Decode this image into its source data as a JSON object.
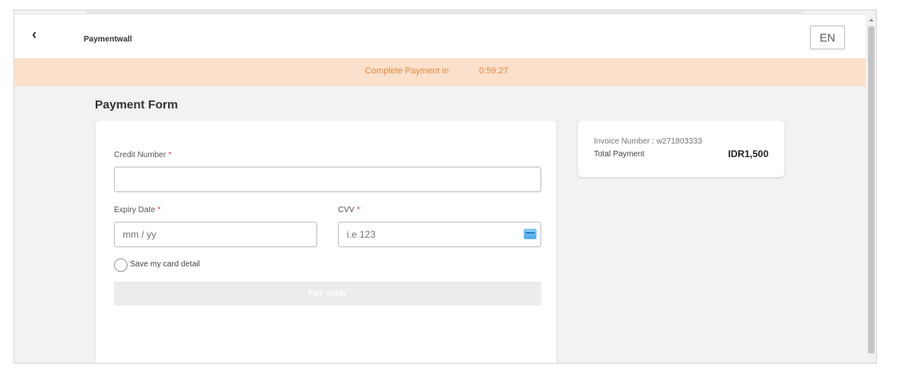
{
  "header": {
    "back_icon": "chevron-left-icon",
    "back_glyph": "‹",
    "brand": "Paymentwall",
    "language": "EN"
  },
  "timer": {
    "label": "Complete Payment in",
    "value": "0:59:27"
  },
  "form": {
    "title": "Payment Form",
    "credit_number_label": "Credit Number",
    "credit_number_value": "",
    "expiry_label": "Expiry Date",
    "expiry_placeholder": "mm / yy",
    "cvv_label": "CVV",
    "cvv_placeholder": "i.e 123",
    "required_mark": "*",
    "save_card_label": "Save my card detail",
    "pay_button": "PAY NOW"
  },
  "invoice": {
    "number_text": "Invoice Number : w271803333",
    "total_label": "Total Payment",
    "total_value": "IDR1,500"
  },
  "colors": {
    "timer_bg": "#fbe0cc",
    "timer_text": "#e58a3c",
    "required": "#e53935"
  }
}
